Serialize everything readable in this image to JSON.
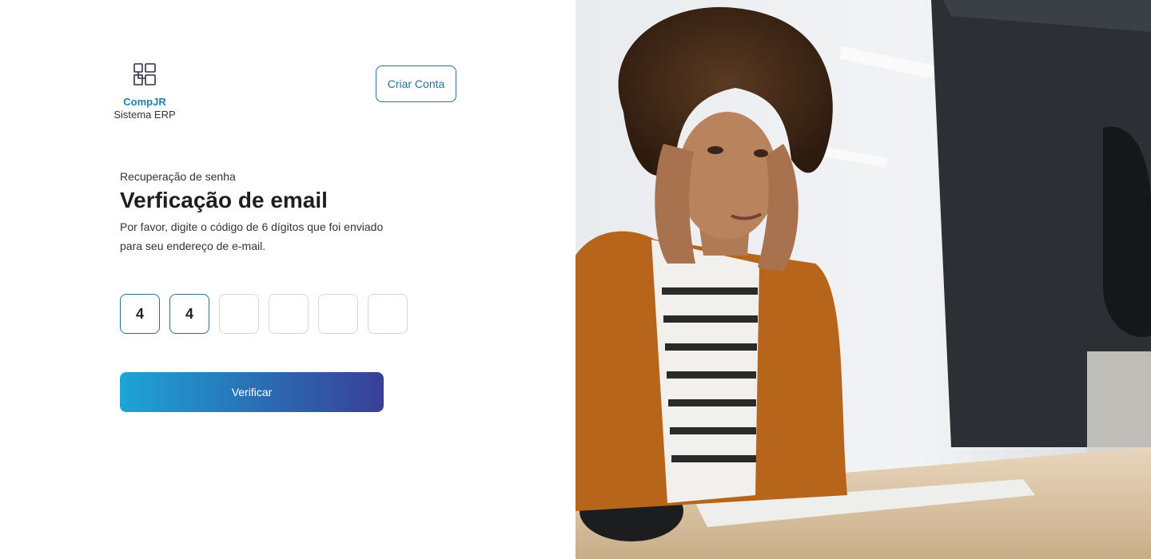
{
  "brand": {
    "name": "CompJR",
    "subtitle": "Sistema ERP",
    "icon": "layout-grid-logo-icon",
    "color": "#1e7fb0"
  },
  "header": {
    "create_account_label": "Criar Conta"
  },
  "form": {
    "eyebrow": "Recuperação de senha",
    "title": "Verficação de email",
    "description": "Por favor, digite o código de 6 dígitos que foi enviado para seu endereço de e-mail.",
    "code_digits": [
      "4",
      "4",
      "",
      "",
      "",
      ""
    ],
    "verify_label": "Verificar"
  },
  "colors": {
    "accent": "#2a6e9a",
    "button_gradient_start": "#1ea4d8",
    "button_gradient_end": "#3a3f96"
  }
}
